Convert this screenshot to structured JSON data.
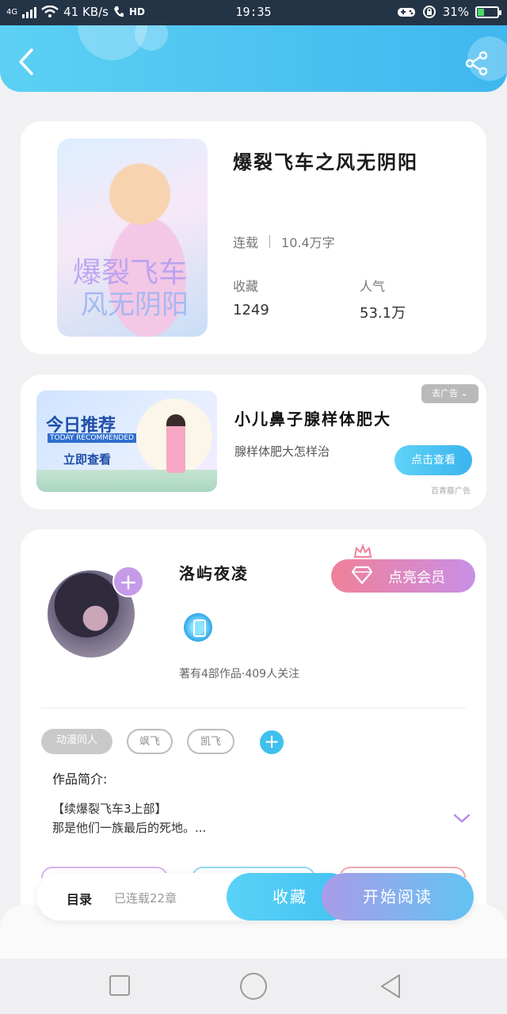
{
  "status_bar": {
    "network": "4G",
    "speed": "41 KB/s",
    "hd": "HD",
    "time": "19:35",
    "battery": "31%",
    "battery_level": 0.31
  },
  "header": {
    "back_icon": "back-arrow-icon",
    "share_icon": "share-icon"
  },
  "book": {
    "cover_text_1": "爆裂飞车",
    "cover_text_2": "风无阴阳",
    "title": "爆裂飞车之风无阴阳",
    "status": "连载",
    "word_count": "10.4万字",
    "collect_label": "收藏",
    "collect_value": "1249",
    "popularity_label": "人气",
    "popularity_value": "53.1万"
  },
  "ad": {
    "image_title": "今日推荐",
    "image_subtitle": "TODAY RECOMMENDED",
    "image_cta": "立即查看",
    "title": "小儿鼻子腺样体肥大",
    "description": "腺样体肥大怎样治",
    "close_label": "去广告",
    "button_label": "点击查看",
    "source": "百青藤广告"
  },
  "author": {
    "name": "洛屿夜凌",
    "meta": "著有4部作品·409人关注",
    "vip_label": "点亮会员",
    "add_label": "+"
  },
  "tags": [
    "动漫同人",
    "飒飞",
    "凯飞"
  ],
  "tag_add_label": "+",
  "intro": {
    "label": "作品简介:",
    "line1": "【续爆裂飞车3上部】",
    "line2": "那是他们一族最后的死地。..."
  },
  "action_bar": {
    "toc_label": "目录",
    "toc_status": "已连载22章",
    "collect_label": "收藏",
    "read_label": "开始阅读"
  },
  "colors": {
    "accent": "#43c1f1",
    "vip_start": "#f08099",
    "vip_end": "#c98fe6",
    "status_bar": "#243447"
  }
}
